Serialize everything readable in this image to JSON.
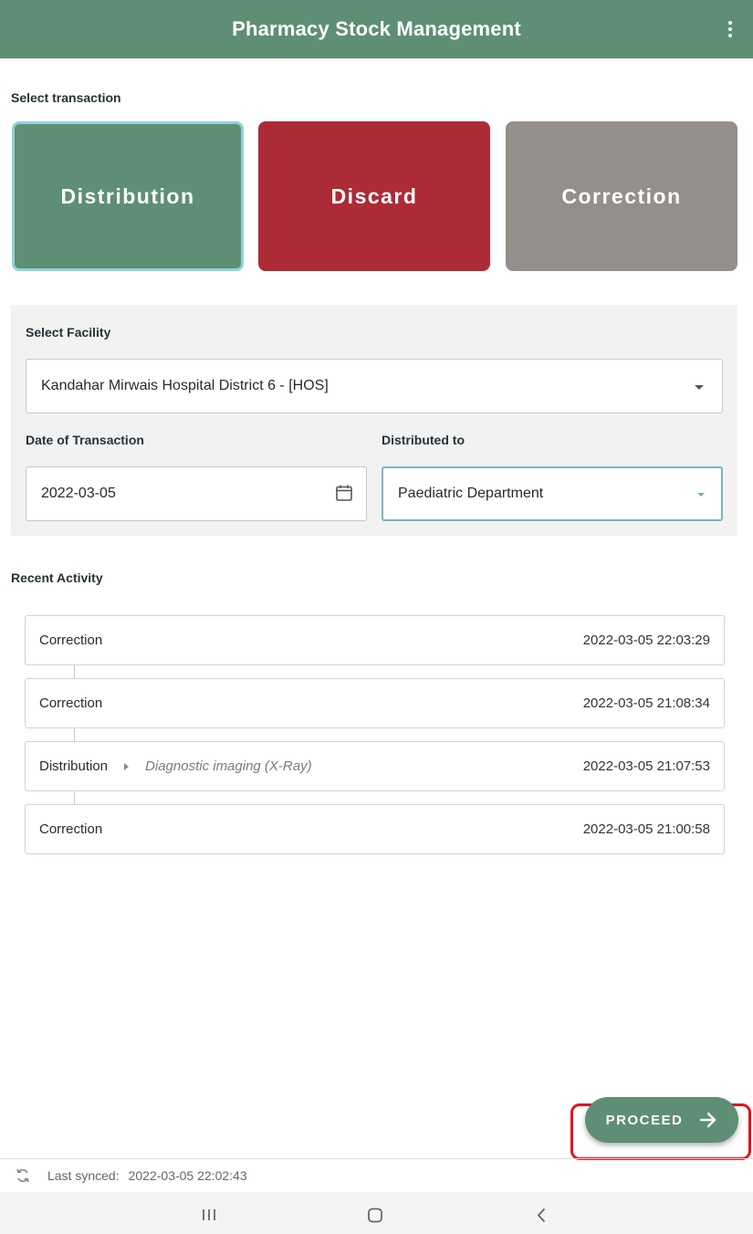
{
  "appbar": {
    "title": "Pharmacy Stock Management",
    "menu_icon": "more-vert-icon"
  },
  "transaction": {
    "label": "Select transaction",
    "selected": "Distribution",
    "options": [
      "Distribution",
      "Discard",
      "Correction"
    ]
  },
  "form": {
    "facility_label": "Select Facility",
    "facility_value": "Kandahar Mirwais Hospital District 6 -  [HOS]",
    "date_label": "Date of Transaction",
    "date_value": "2022-03-05",
    "distributed_label": "Distributed to",
    "distributed_value": "Paediatric Department"
  },
  "recent": {
    "label": "Recent Activity",
    "items": [
      {
        "type": "Correction",
        "destination": "",
        "timestamp": "2022-03-05 22:03:29"
      },
      {
        "type": "Correction",
        "destination": "",
        "timestamp": "2022-03-05 21:08:34"
      },
      {
        "type": "Distribution",
        "destination": "Diagnostic imaging (X-Ray)",
        "timestamp": "2022-03-05 21:07:53"
      },
      {
        "type": "Correction",
        "destination": "",
        "timestamp": "2022-03-05 21:00:58"
      }
    ]
  },
  "proceed": {
    "label": "PROCEED",
    "icon": "arrow-right-icon"
  },
  "sync": {
    "label": "Last synced:",
    "value": "2022-03-05 22:02:43",
    "icon": "sync-icon"
  },
  "colors": {
    "primary": "#5e8f74",
    "discard": "#ad2a37",
    "correction": "#958f8c",
    "highlight": "#e0141e"
  }
}
